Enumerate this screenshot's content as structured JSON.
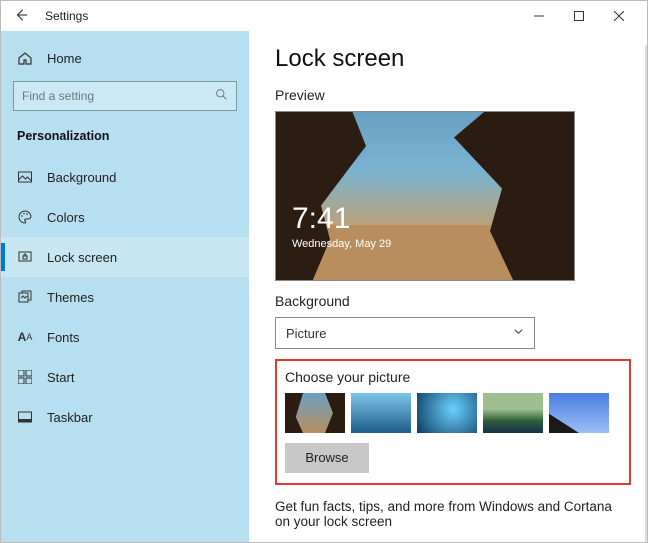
{
  "titlebar": {
    "title": "Settings"
  },
  "sidebar": {
    "home": "Home",
    "search_placeholder": "Find a setting",
    "category": "Personalization",
    "items": [
      {
        "label": "Background"
      },
      {
        "label": "Colors"
      },
      {
        "label": "Lock screen"
      },
      {
        "label": "Themes"
      },
      {
        "label": "Fonts"
      },
      {
        "label": "Start"
      },
      {
        "label": "Taskbar"
      }
    ]
  },
  "main": {
    "heading": "Lock screen",
    "preview_label": "Preview",
    "clock": {
      "time": "7:41",
      "date": "Wednesday, May 29"
    },
    "background_label": "Background",
    "background_value": "Picture",
    "choose_label": "Choose your picture",
    "browse_label": "Browse",
    "tip": "Get fun facts, tips, and more from Windows and Cortana on your lock screen"
  }
}
